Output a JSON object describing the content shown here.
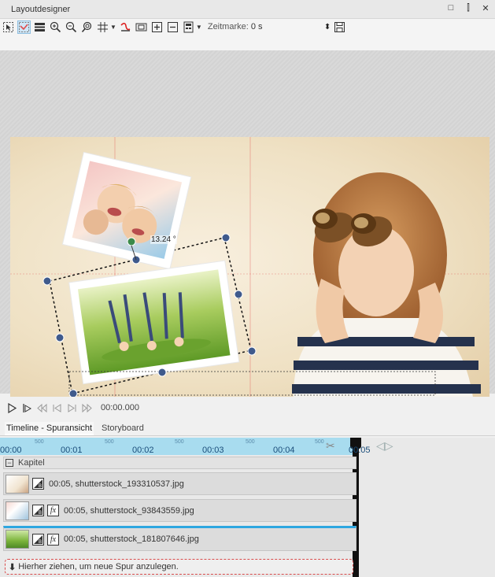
{
  "window": {
    "title": "Layoutdesigner",
    "buttons": [
      "□",
      "⫿",
      "✕"
    ]
  },
  "toolbar": {
    "zeitmarke_label": "Zeitmarke:",
    "zeitmarke_value": "0 s",
    "icons": [
      "select-tool-icon",
      "align-icon",
      "distribute-icon",
      "zoom-fit-icon",
      "zoom-in-icon",
      "zoom-out-icon",
      "grid-icon",
      "curve-icon",
      "fit-icon",
      "plus-icon",
      "minus-icon",
      "template-icon",
      "save-icon"
    ]
  },
  "stage": {
    "rotation_label": "13.24 °"
  },
  "playback": {
    "time": "00:00.000"
  },
  "tabs": [
    {
      "label": "Timeline - Spuransicht",
      "active": true
    },
    {
      "label": "Storyboard",
      "active": false
    }
  ],
  "timeline": {
    "ruler": [
      "00:00",
      "00:01",
      "00:02",
      "00:03",
      "00:04",
      "00:05"
    ],
    "mini": [
      "500",
      "500",
      "500",
      "500",
      "500"
    ],
    "kapitel_label": "Kapitel",
    "tracks": [
      {
        "label": "00:05, shutterstock_193310537.jpg",
        "fx": false,
        "selected": false
      },
      {
        "label": "00:05, shutterstock_93843559.jpg",
        "fx": true,
        "selected": false
      },
      {
        "label": "00:05, shutterstock_181807646.jpg",
        "fx": true,
        "selected": true
      }
    ],
    "drop_hint": "Hierher ziehen, um neue Spur anzulegen."
  },
  "colors": {
    "ruler": "#a8dcef",
    "accent_selected": "#2ea7e0",
    "guide_line": "#e04a4a",
    "handle": "#3f5a8c"
  }
}
